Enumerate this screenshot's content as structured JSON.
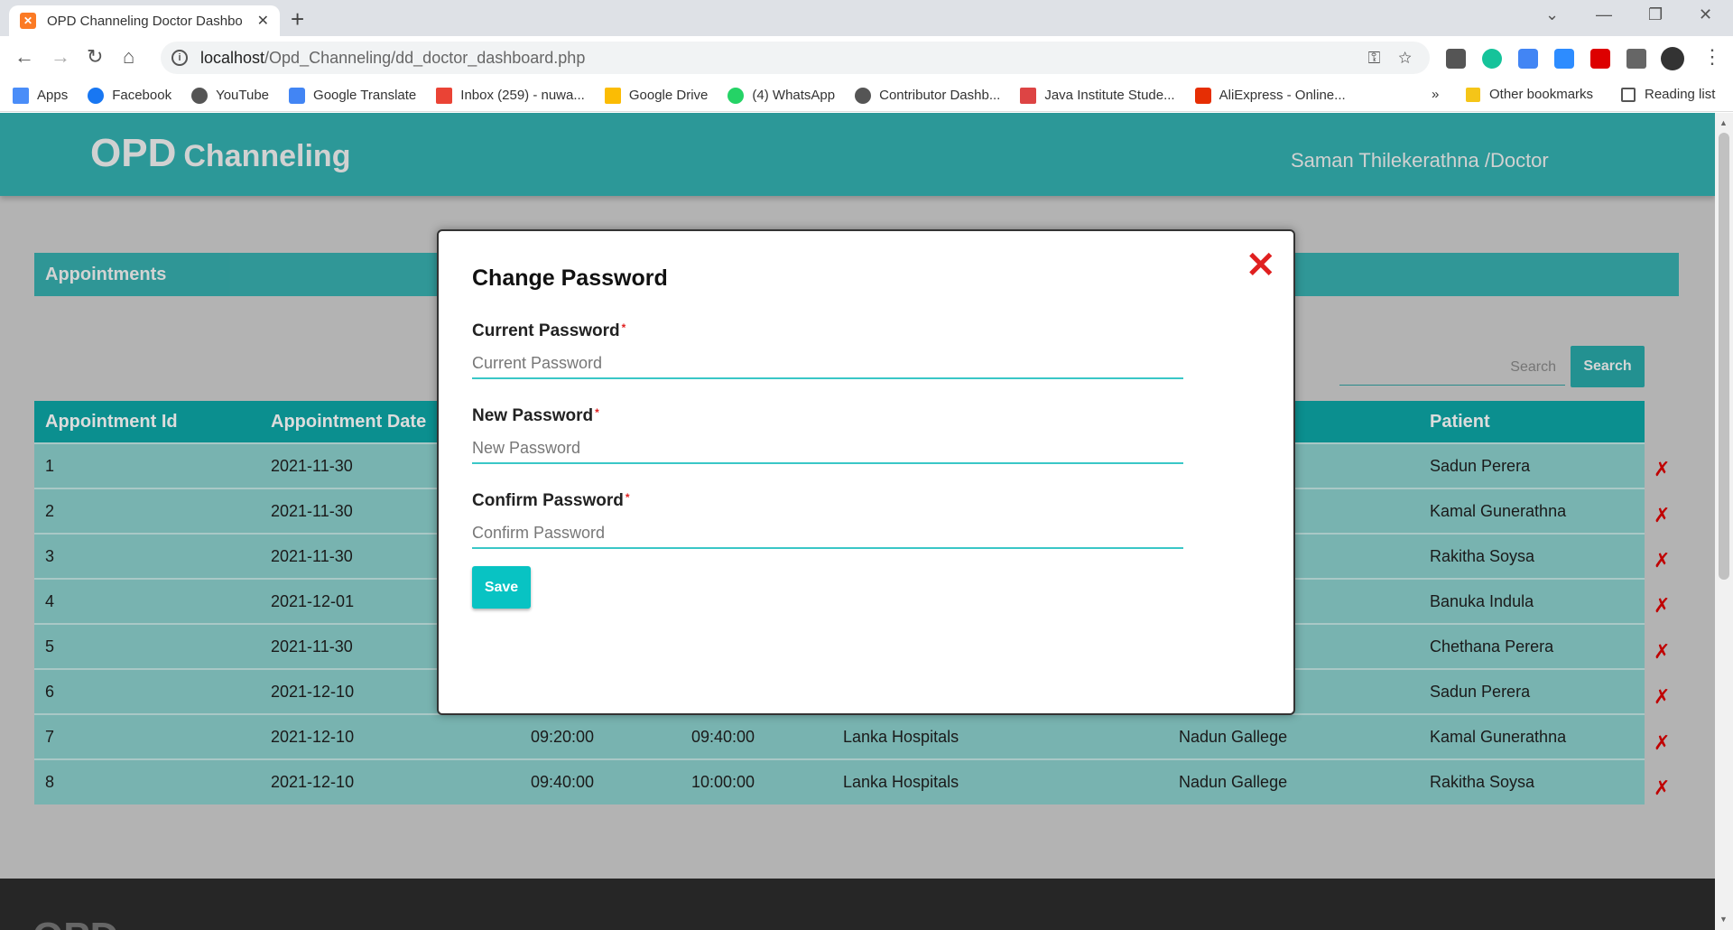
{
  "browser": {
    "tab_title": "OPD Channeling Doctor Dashbo",
    "url_host": "localhost",
    "url_path": "/Opd_Channeling/dd_doctor_dashboard.php",
    "bookmarks": [
      "Apps",
      "Facebook",
      "YouTube",
      "Google Translate",
      "Inbox (259) - nuwa...",
      "Google Drive",
      "(4) WhatsApp",
      "Contributor Dashb...",
      "Java Institute Stude...",
      "AliExpress - Online..."
    ],
    "bookmarks_more": "»",
    "other_bookmarks": "Other bookmarks",
    "reading_list": "Reading list"
  },
  "header": {
    "brand_big": "OPD",
    "brand_small": "Channeling",
    "user": "Saman Thilekerathna /Doctor"
  },
  "section_title": "Appointments",
  "search": {
    "placeholder": "Search",
    "button": "Search"
  },
  "table": {
    "columns": [
      "Appointment Id",
      "Appointment Date",
      "",
      "",
      "",
      "",
      "Patient"
    ],
    "rows": [
      [
        "1",
        "2021-11-30",
        "",
        "",
        "",
        "thna",
        "Sadun Perera"
      ],
      [
        "2",
        "2021-11-30",
        "",
        "",
        "",
        "thna",
        "Kamal Gunerathna"
      ],
      [
        "3",
        "2021-11-30",
        "",
        "",
        "",
        "thna",
        "Rakitha Soysa"
      ],
      [
        "4",
        "2021-12-01",
        "",
        "",
        "",
        "thna",
        "Banuka Indula"
      ],
      [
        "5",
        "2021-11-30",
        "",
        "",
        "",
        "thna",
        "Chethana Perera"
      ],
      [
        "6",
        "2021-12-10",
        "",
        "",
        "",
        "",
        "Sadun Perera"
      ],
      [
        "7",
        "2021-12-10",
        "09:20:00",
        "09:40:00",
        "Lanka Hospitals",
        "Nadun Gallege",
        "Kamal Gunerathna"
      ],
      [
        "8",
        "2021-12-10",
        "09:40:00",
        "10:00:00",
        "Lanka Hospitals",
        "Nadun Gallege",
        "Rakitha Soysa"
      ]
    ],
    "delete_glyph": "✗"
  },
  "footer_text": "OPD",
  "modal": {
    "title": "Change Password",
    "close_glyph": "✕",
    "fields": [
      {
        "label": "Current Password",
        "placeholder": "Current Password"
      },
      {
        "label": "New Password",
        "placeholder": "New Password"
      },
      {
        "label": "Confirm Password",
        "placeholder": "Confirm Password"
      }
    ],
    "required_mark": "*",
    "save": "Save"
  },
  "colors": {
    "teal": "#009090",
    "accent": "#08c3c3",
    "danger": "#e02020"
  }
}
